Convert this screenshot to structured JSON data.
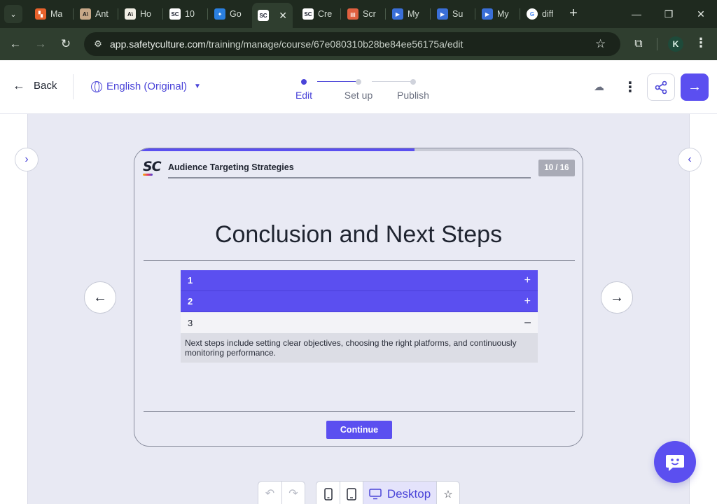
{
  "browser": {
    "tabs": [
      {
        "title": "Ma",
        "favicon_color": "#e8622c",
        "favicon_glyph": "⁞"
      },
      {
        "title": "Ant",
        "favicon_color": "#c8a888",
        "favicon_glyph": "A\\"
      },
      {
        "title": "Ho",
        "favicon_color": "#f2efe6",
        "favicon_glyph": "A\\"
      },
      {
        "title": "10",
        "favicon_color": "#ffffff",
        "favicon_glyph": "SC"
      },
      {
        "title": "Go",
        "favicon_color": "#2a7fe0",
        "favicon_glyph": "✦"
      },
      {
        "title": "",
        "favicon_color": "#ffffff",
        "favicon_glyph": "SC",
        "active": true
      },
      {
        "title": "Cre",
        "favicon_color": "#ffffff",
        "favicon_glyph": "SC"
      },
      {
        "title": "Scr",
        "favicon_color": "#e06040",
        "favicon_glyph": "▤"
      },
      {
        "title": "My",
        "favicon_color": "#3a6fd8",
        "favicon_glyph": "▶"
      },
      {
        "title": "Su",
        "favicon_color": "#3a6fd8",
        "favicon_glyph": "▶"
      },
      {
        "title": "My",
        "favicon_color": "#3a6fd8",
        "favicon_glyph": "▶"
      },
      {
        "title": "diff",
        "favicon_color": "#ffffff",
        "favicon_glyph": "G"
      }
    ],
    "url_host": "app.safetyculture.com",
    "url_path": "/training/manage/course/67e080310b28be84ee56175a/edit",
    "profile_initial": "K"
  },
  "header": {
    "back_label": "Back",
    "language_label": "English (Original)",
    "steps": [
      {
        "label": "Edit",
        "current": true
      },
      {
        "label": "Set up",
        "current": false
      },
      {
        "label": "Publish",
        "current": false
      }
    ]
  },
  "slide": {
    "logo_text": "SC",
    "course_title": "Audience Targeting Strategies",
    "page_indicator": "10 / 16",
    "progress_fraction": 0.625,
    "heading": "Conclusion and Next Steps",
    "accordion": [
      {
        "label": "1",
        "expanded": false,
        "toggle": "+"
      },
      {
        "label": "2",
        "expanded": false,
        "toggle": "+"
      },
      {
        "label": "3",
        "expanded": true,
        "toggle": "–"
      }
    ],
    "expanded_body": "Next steps include setting clear objectives, choosing the right platforms, and continuously monitoring performance.",
    "continue_label": "Continue"
  },
  "device_bar": {
    "desktop_label": "Desktop"
  },
  "colors": {
    "accent": "#5b4ff0",
    "accent_text": "#4a44d8"
  }
}
